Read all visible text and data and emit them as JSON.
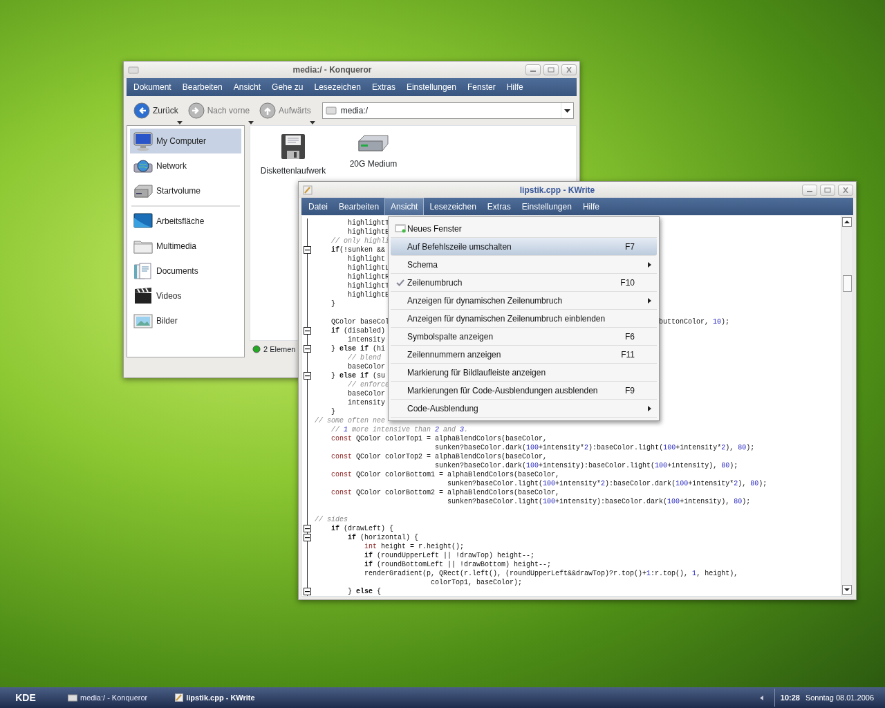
{
  "konqueror": {
    "title": "media:/ - Konqueror",
    "active": false,
    "menu": [
      "Dokument",
      "Bearbeiten",
      "Ansicht",
      "Gehe zu",
      "Lesezeichen",
      "Extras",
      "Einstellungen",
      "Fenster",
      "Hilfe"
    ],
    "toolbar": [
      {
        "label": "Zurück",
        "kind": "back",
        "disabled": false
      },
      {
        "label": "Nach vorne",
        "kind": "forward",
        "disabled": true
      },
      {
        "label": "Aufwärts",
        "kind": "up",
        "disabled": true
      }
    ],
    "location": {
      "value": "media:/"
    },
    "sidebar": {
      "groups": [
        {
          "items": [
            {
              "label": "My Computer",
              "kind": "monitor",
              "selected": true
            },
            {
              "label": "Network",
              "kind": "globe",
              "selected": false
            },
            {
              "label": "Startvolume",
              "kind": "drive",
              "selected": false
            }
          ]
        },
        {
          "items": [
            {
              "label": "Arbeitsfläche",
              "kind": "desktop",
              "selected": false
            },
            {
              "label": "Multimedia",
              "kind": "folder",
              "selected": false
            },
            {
              "label": "Documents",
              "kind": "documents",
              "selected": false
            },
            {
              "label": "Videos",
              "kind": "video",
              "selected": false
            },
            {
              "label": "Bilder",
              "kind": "picture",
              "selected": false
            }
          ]
        }
      ]
    },
    "files": [
      {
        "label": "Diskettenlaufwerk",
        "kind": "floppy"
      },
      {
        "label": "20G Medium",
        "kind": "drive"
      }
    ],
    "status": "2 Elemen"
  },
  "kwrite": {
    "title": "lipstik.cpp - KWrite",
    "active": true,
    "menu": [
      {
        "label": "Datei",
        "selected": false
      },
      {
        "label": "Bearbeiten",
        "selected": false
      },
      {
        "label": "Ansicht",
        "selected": true
      },
      {
        "label": "Lesezeichen",
        "selected": false
      },
      {
        "label": "Extras",
        "selected": false
      },
      {
        "label": "Einstellungen",
        "selected": false
      },
      {
        "label": "Hilfe",
        "selected": false
      }
    ],
    "code": [
      {
        "text": "        highlightT",
        "kind": "code",
        "fold": false
      },
      {
        "text": "        highlightB",
        "kind": "code",
        "fold": false
      },
      {
        "text": "    // only highli",
        "kind": "comment",
        "fold": false
      },
      {
        "text": "    if(!sunken &&",
        "kind": "code",
        "fold": true
      },
      {
        "text": "        highlight",
        "kind": "code",
        "fold": false
      },
      {
        "text": "        highlightL",
        "kind": "code",
        "fold": false
      },
      {
        "text": "        highlightR",
        "kind": "code",
        "fold": false
      },
      {
        "text": "        highlightT",
        "kind": "code",
        "fold": false
      },
      {
        "text": "        highlightB",
        "kind": "code",
        "fold": false
      },
      {
        "text": "    }",
        "kind": "code",
        "fold": false
      },
      {
        "kind": "code",
        "fold": false
      },
      {
        "text": "    QColor baseCol",
        "kind": "code",
        "fold": false,
        "tail": "buttonColor, 10);"
      },
      {
        "text": "    if (disabled)",
        "kind": "code",
        "fold": true
      },
      {
        "text": "        intensity",
        "kind": "code",
        "fold": false
      },
      {
        "text": "    } else if (hi",
        "kind": "code",
        "fold": true
      },
      {
        "text": "        // blend",
        "kind": "comment",
        "fold": false
      },
      {
        "text": "        baseColor",
        "kind": "code",
        "fold": false
      },
      {
        "text": "    } else if (su",
        "kind": "code",
        "fold": true
      },
      {
        "text": "        // enforce",
        "kind": "comment",
        "fold": false
      },
      {
        "text": "        baseColor",
        "kind": "code",
        "fold": false
      },
      {
        "text": "        intensity",
        "kind": "code",
        "fold": false
      },
      {
        "text": "    }",
        "kind": "code",
        "fold": false
      },
      {
        "text": "// some often nee",
        "kind": "comment",
        "fold": false
      },
      {
        "text": "    // 1 more intensive than 2 and 3.",
        "kind": "comment",
        "fold": false
      },
      {
        "text": "    const QColor colorTop1 = alphaBlendColors(baseColor,",
        "kind": "code",
        "fold": false
      },
      {
        "text": "                             sunken?baseColor.dark(100+intensity*2):baseColor.light(100+intensity*2), 80);",
        "kind": "code",
        "fold": false
      },
      {
        "text": "    const QColor colorTop2 = alphaBlendColors(baseColor,",
        "kind": "code",
        "fold": false
      },
      {
        "text": "                             sunken?baseColor.dark(100+intensity):baseColor.light(100+intensity), 80);",
        "kind": "code",
        "fold": false
      },
      {
        "text": "    const QColor colorBottom1 = alphaBlendColors(baseColor,",
        "kind": "code",
        "fold": false
      },
      {
        "text": "                                sunken?baseColor.light(100+intensity*2):baseColor.dark(100+intensity*2), 80);",
        "kind": "code",
        "fold": false
      },
      {
        "text": "    const QColor colorBottom2 = alphaBlendColors(baseColor,",
        "kind": "code",
        "fold": false
      },
      {
        "text": "                                sunken?baseColor.light(100+intensity):baseColor.dark(100+intensity), 80);",
        "kind": "code",
        "fold": false
      },
      {
        "kind": "code",
        "fold": false
      },
      {
        "text": "// sides",
        "kind": "comment",
        "fold": false
      },
      {
        "text": "    if (drawLeft) {",
        "kind": "code",
        "fold": true
      },
      {
        "text": "        if (horizontal) {",
        "kind": "code",
        "fold": true
      },
      {
        "text": "            int height = r.height();",
        "kind": "code",
        "fold": false
      },
      {
        "text": "            if (roundUpperLeft || !drawTop) height--;",
        "kind": "code",
        "fold": false
      },
      {
        "text": "            if (roundBottomLeft || !drawBottom) height--;",
        "kind": "code",
        "fold": false
      },
      {
        "text": "            renderGradient(p, QRect(r.left(), (roundUpperLeft&&drawTop)?r.top()+1:r.top(), 1, height),",
        "kind": "code",
        "fold": false
      },
      {
        "text": "                            colorTop1, baseColor);",
        "kind": "code",
        "fold": false
      },
      {
        "text": "        } else {",
        "kind": "code",
        "fold": true
      }
    ],
    "popup": [
      {
        "label": "Neues Fenster",
        "kind": "icon",
        "checked": false,
        "selected": false
      },
      {
        "label": "Auf Befehlszeile umschalten",
        "shortcut": "F7",
        "kind": "plain",
        "checked": false,
        "selected": true
      },
      {
        "label": "Schema",
        "kind": "submenu",
        "checked": false,
        "selected": false
      },
      {
        "label": "Zeilenumbruch",
        "shortcut": "F10",
        "kind": "plain",
        "checked": true,
        "selected": false
      },
      {
        "label": "Anzeigen für dynamischen Zeilenumbruch",
        "kind": "submenu",
        "checked": false,
        "selected": false
      },
      {
        "label": "Anzeigen für dynamischen Zeilenumbruch einblenden",
        "kind": "plain",
        "checked": false,
        "selected": false
      },
      {
        "label": "Symbolspalte anzeigen",
        "shortcut": "F6",
        "kind": "plain",
        "checked": false,
        "selected": false
      },
      {
        "label": "Zeilennummern anzeigen",
        "shortcut": "F11",
        "kind": "plain",
        "checked": false,
        "selected": false
      },
      {
        "label": "Markierung für Bildlaufleiste anzeigen",
        "kind": "plain",
        "checked": false,
        "selected": false
      },
      {
        "label": "Markierungen für Code-Ausblendungen ausblenden",
        "shortcut": "F9",
        "kind": "plain",
        "checked": false,
        "selected": false
      },
      {
        "label": "Code-Ausblendung",
        "kind": "submenu",
        "checked": false,
        "selected": false
      }
    ]
  },
  "taskbar": {
    "start": "KDE",
    "tasks": [
      {
        "label": "media:/ - Konqueror",
        "kind": "folder",
        "selected": false
      },
      {
        "label": "lipstik.cpp - KWrite",
        "kind": "editor",
        "selected": true
      }
    ],
    "time": "10:28",
    "date": "Sonntag 08.01.2006"
  }
}
